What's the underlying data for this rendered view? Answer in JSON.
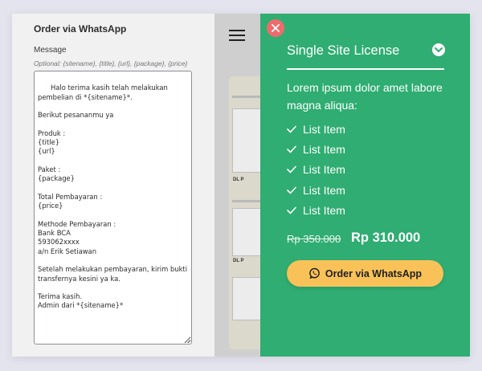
{
  "settings_panel": {
    "title": "Order via WhatsApp",
    "message_label": "Message",
    "message_hint": "Optional: {sitename}, {title}, {url}, {package}, {price}",
    "message_value": "Halo terima kasih telah melakukan pembelian di *{sitename}*.\n\nBerikut pesananmu ya\n\nProduk :\n{title}\n{url}\n\nPaket :\n{package}\n\nTotal Pembayaran :\n{price}\n\nMethode Pembayaran :\nBank BCA\n593062xxxx\na/n Erik Setiawan\n\nSetelah melakukan pembayaran, kirim bukti transfernya kesini ya ka.\n\nTerima kasih.\nAdmin dari *{sitename}*"
  },
  "preview": {
    "tags": [
      "DL P",
      "DL P"
    ]
  },
  "popup": {
    "title": "Single Site License",
    "description": "Lorem ipsum dolor amet labore magna aliqua:",
    "features": [
      "List Item",
      "List Item",
      "List Item",
      "List Item",
      "List Item"
    ],
    "price_old": "Rp 350.000",
    "price_new": "Rp 310.000",
    "order_button": "Order via WhatsApp"
  },
  "icons": {
    "close": "close-icon",
    "toggle": "chevron-down-icon",
    "feature": "check-icon",
    "whatsapp": "whatsapp-icon",
    "menu": "hamburger-icon"
  },
  "colors": {
    "popup_bg": "#2fad72",
    "button_bg": "#f8c259",
    "close_bg": "#ef6b6b"
  }
}
